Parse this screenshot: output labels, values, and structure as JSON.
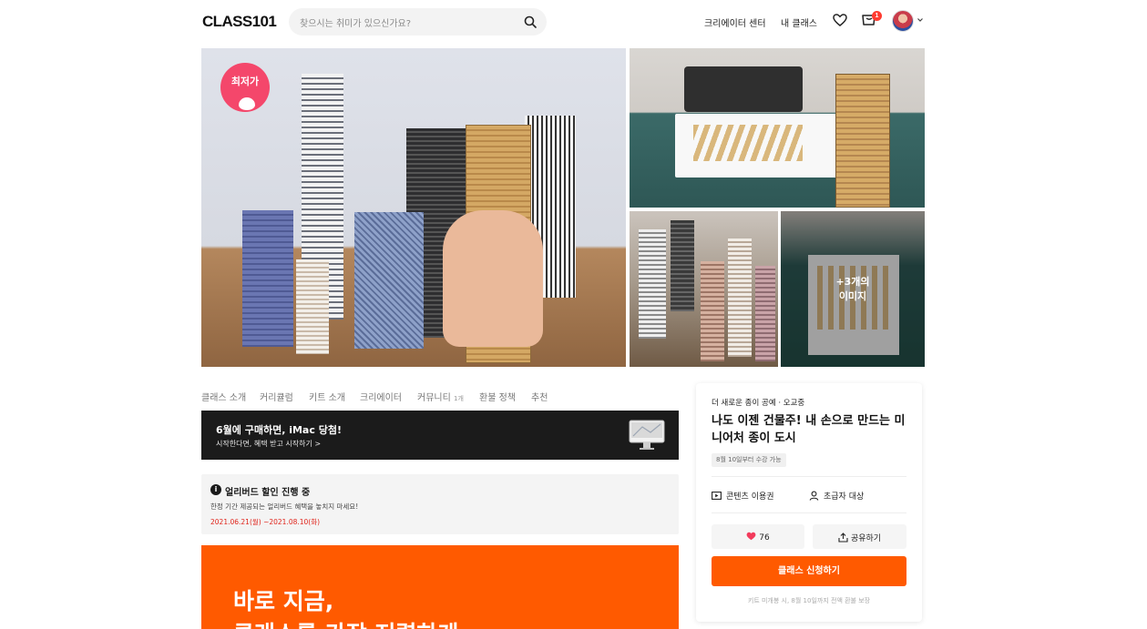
{
  "header": {
    "logo": "CLASS101",
    "search_placeholder": "찾으시는 취미가 있으신가요?",
    "nav": [
      "크리에이터 센터",
      "내 클래스"
    ],
    "cart_badge": "1"
  },
  "gallery": {
    "lowest_badge": "최저가",
    "more_images": "+3개의\n이미지"
  },
  "tabs": [
    {
      "label": "클래스 소개",
      "count": ""
    },
    {
      "label": "커리큘럼",
      "count": ""
    },
    {
      "label": "키트 소개",
      "count": ""
    },
    {
      "label": "크리에이터",
      "count": ""
    },
    {
      "label": "커뮤니티",
      "count": "1개"
    },
    {
      "label": "환불 정책",
      "count": ""
    },
    {
      "label": "추천",
      "count": ""
    }
  ],
  "promo": {
    "title": "6월에 구매하면, iMac 당첨!",
    "subtitle": "시작한다면, 혜택 받고 시작하기 >"
  },
  "early_bird": {
    "title": "얼리버드 할인 진행 중",
    "description": "한정 기간 제공되는 얼리버드 혜택을 놓치지 마세요!",
    "period": "2021.06.21(월) ~2021.08.10(화)"
  },
  "orange_banner": {
    "line1": "바로 지금,",
    "line2": "클래스를 가장 저렴하게"
  },
  "card": {
    "category": "더 새로운 종이 공예 · 오교중",
    "title": "나도 이젠 건물주! 내 손으로 만드는 미니어처 종이 도시",
    "chip": "8월 10일부터 수강 가능",
    "meta_content": "콘텐츠 이용권",
    "meta_level": "초급자 대상",
    "likes": "76",
    "share": "공유하기",
    "apply": "클래스 신청하기",
    "note": "키트 미개봉 시, 8월 10일까지 전액 환불 보장"
  },
  "colors": {
    "accent": "#ff5a00",
    "lowest_badge": "#f4476b",
    "alert_red": "#e0241b",
    "dark_banner": "#1b1b1b"
  }
}
